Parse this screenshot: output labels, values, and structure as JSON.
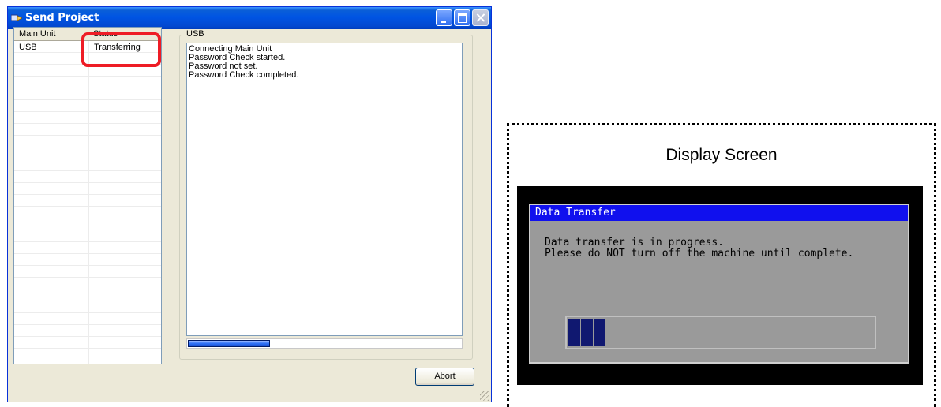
{
  "window": {
    "title": "Send Project",
    "controls": [
      "minimize",
      "maximize",
      "close"
    ]
  },
  "list": {
    "columns": [
      "Main Unit",
      "Status"
    ],
    "rows": [
      {
        "main_unit": "USB",
        "status": "Transferring"
      }
    ]
  },
  "usb": {
    "group_label": "USB",
    "log": [
      "Connecting Main Unit",
      "Password Check started.",
      "Password not set.",
      "Password Check completed."
    ],
    "progress_fraction": 0.3
  },
  "buttons": {
    "abort": "Abort"
  },
  "display": {
    "caption": "Display Screen",
    "dialog_title": "Data Transfer",
    "message_line1": "Data transfer is in progress.",
    "message_line2": "Please do NOT turn off the machine until complete.",
    "progress_blocks": 3
  },
  "colors": {
    "highlight": "#ee1c25",
    "dialog_title_bg": "#1010ee",
    "progress_block": "#101870"
  }
}
